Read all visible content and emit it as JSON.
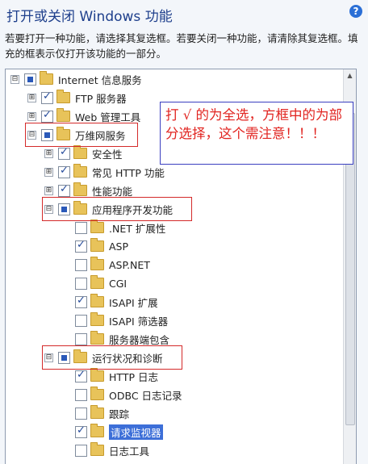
{
  "title": "打开或关闭 Windows 功能",
  "help_icon": "?",
  "description": "若要打开一种功能，请选择其复选框。若要关闭一种功能，请清除其复选框。填充的框表示仅打开该功能的一部分。",
  "annotation": "打 √ 的为全选，方框中的为部分选择，这个需注意！！！",
  "tree": {
    "items": [
      {
        "label": "Internet 信息服务",
        "expander": "⊟",
        "state": "partial"
      },
      {
        "label": "FTP 服务器",
        "expander": "⊞",
        "state": "checked"
      },
      {
        "label": "Web 管理工具",
        "expander": "⊞",
        "state": "checked"
      },
      {
        "label": "万维网服务",
        "expander": "⊟",
        "state": "partial"
      },
      {
        "label": "安全性",
        "expander": "⊞",
        "state": "checked"
      },
      {
        "label": "常见 HTTP 功能",
        "expander": "⊞",
        "state": "checked"
      },
      {
        "label": "性能功能",
        "expander": "⊞",
        "state": "checked"
      },
      {
        "label": "应用程序开发功能",
        "expander": "⊟",
        "state": "partial"
      },
      {
        "label": ".NET 扩展性",
        "expander": "",
        "state": "unchecked"
      },
      {
        "label": "ASP",
        "expander": "",
        "state": "checked"
      },
      {
        "label": "ASP.NET",
        "expander": "",
        "state": "unchecked"
      },
      {
        "label": "CGI",
        "expander": "",
        "state": "unchecked"
      },
      {
        "label": "ISAPI 扩展",
        "expander": "",
        "state": "checked"
      },
      {
        "label": "ISAPI 筛选器",
        "expander": "",
        "state": "unchecked"
      },
      {
        "label": "服务器端包含",
        "expander": "",
        "state": "unchecked"
      },
      {
        "label": "运行状况和诊断",
        "expander": "⊟",
        "state": "partial"
      },
      {
        "label": "HTTP 日志",
        "expander": "",
        "state": "checked"
      },
      {
        "label": "ODBC 日志记录",
        "expander": "",
        "state": "unchecked"
      },
      {
        "label": "跟踪",
        "expander": "",
        "state": "unchecked"
      },
      {
        "label": "请求监视器",
        "expander": "",
        "state": "checked",
        "selected": true
      },
      {
        "label": "日志工具",
        "expander": "",
        "state": "unchecked"
      }
    ]
  }
}
